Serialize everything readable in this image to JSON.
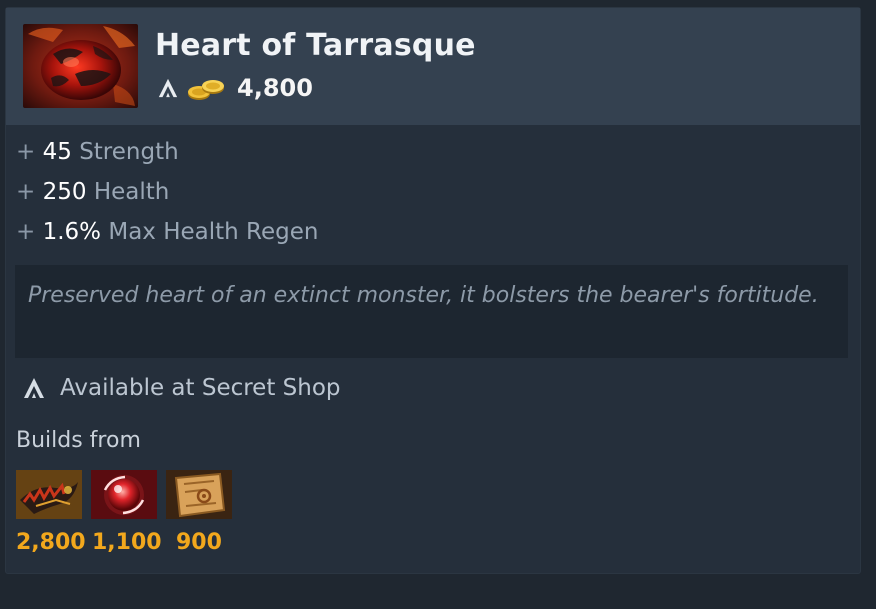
{
  "item": {
    "name": "Heart of Tarrasque",
    "icon": "heart-of-tarrasque-icon",
    "cost": "4,800"
  },
  "stats": [
    {
      "plus": "+",
      "value": "45",
      "name": "Strength"
    },
    {
      "plus": "+",
      "value": "250",
      "name": "Health"
    },
    {
      "plus": "+",
      "value": "1.6%",
      "name": "Max Health Regen"
    }
  ],
  "lore": "Preserved heart of an extinct monster, it bolsters the bearer's fortitude.",
  "availability": "Available at Secret Shop",
  "builds": {
    "title": "Builds from",
    "components": [
      {
        "icon": "reaver-icon",
        "cost": "2,800"
      },
      {
        "icon": "vitality-booster-icon",
        "cost": "1,100"
      },
      {
        "icon": "recipe-scroll-icon",
        "cost": "900"
      }
    ]
  },
  "colors": {
    "panel": "#252f3b",
    "header": "#344150",
    "lore_bg": "#1d2630",
    "gold_text": "#f2a81d"
  }
}
